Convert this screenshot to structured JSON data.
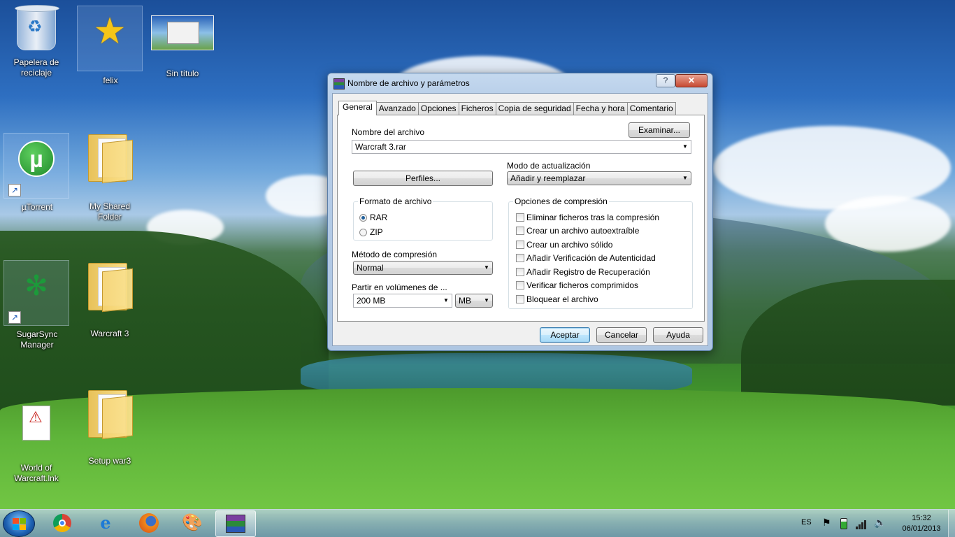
{
  "desktop": {
    "icons": [
      {
        "label": "Papelera de reciclaje"
      },
      {
        "label": "felix"
      },
      {
        "label": "Sin título"
      },
      {
        "label": "µTorrent"
      },
      {
        "label": "My Shared Folder"
      },
      {
        "label": "SugarSync Manager"
      },
      {
        "label": "Warcraft 3"
      },
      {
        "label": "World of Warcraft.lnk"
      },
      {
        "label": "Setup war3"
      }
    ]
  },
  "dialog": {
    "title": "Nombre de archivo y parámetros",
    "help_glyph": "?",
    "close_glyph": "✕",
    "tabs": [
      "General",
      "Avanzado",
      "Opciones",
      "Ficheros",
      "Copia de seguridad",
      "Fecha y hora",
      "Comentario"
    ],
    "active_tab": "General",
    "filename_label": "Nombre del archivo",
    "browse_button": "Examinar...",
    "filename_value": "Warcraft 3.rar",
    "profiles_button": "Perfiles...",
    "update_mode_label": "Modo de actualización",
    "update_mode_value": "Añadir y reemplazar",
    "format_group_label": "Formato de archivo",
    "format_options": [
      "RAR",
      "ZIP"
    ],
    "format_selected": "RAR",
    "compression_method_label": "Método de compresión",
    "compression_method_value": "Normal",
    "split_label": "Partir en volúmenes de ...",
    "split_value": "200 MB",
    "split_unit": "MB",
    "options_group_label": "Opciones de compresión",
    "options": [
      {
        "label": "Eliminar ficheros tras la compresión",
        "checked": false
      },
      {
        "label": "Crear un archivo autoextraíble",
        "checked": false
      },
      {
        "label": "Crear un archivo sólido",
        "checked": false
      },
      {
        "label": "Añadir Verificación de Autenticidad",
        "checked": false
      },
      {
        "label": "Añadir Registro de Recuperación",
        "checked": false
      },
      {
        "label": "Verificar ficheros comprimidos",
        "checked": false
      },
      {
        "label": "Bloquear el archivo",
        "checked": false
      }
    ],
    "ok_button": "Aceptar",
    "cancel_button": "Cancelar",
    "help_button": "Ayuda"
  },
  "taskbar": {
    "pinned": [
      "chrome-icon",
      "internet-explorer-icon",
      "firefox-icon",
      "paint-icon",
      "winrar-icon"
    ],
    "active_item": "winrar-icon",
    "language": "ES",
    "time": "15:32",
    "date": "06/01/2013"
  }
}
